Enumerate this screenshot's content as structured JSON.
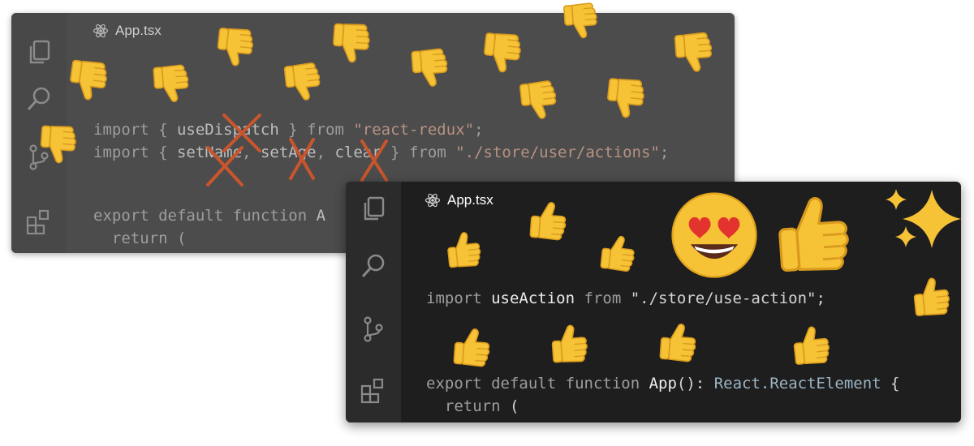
{
  "back_window": {
    "tab": {
      "title": "App.tsx",
      "icon": "react-icon"
    },
    "activity_icons": [
      "files-icon",
      "search-icon",
      "source-control-icon",
      "extensions-icon"
    ],
    "code": {
      "l1": {
        "kw1": "import",
        "p1": " { ",
        "name": "useDispatch",
        "p2": " } ",
        "kw2": "from",
        "p3": " ",
        "str": "\"react-redux\"",
        "end": ";"
      },
      "l2": {
        "kw1": "import",
        "p1": " { ",
        "a": "setName",
        "p2": ", ",
        "b": "setAge",
        "p3": ", ",
        "c": "clear",
        "p4": " } ",
        "kw2": "from",
        "p5": " ",
        "str": "\"./store/user/actions\"",
        "end": ";"
      },
      "l3": {
        "kw1": "export",
        "p1": " ",
        "kw2": "default",
        "p2": " ",
        "kw3": "function",
        "p3": " ",
        "name": "A"
      },
      "l4": {
        "indent": "  ",
        "kw": "return",
        "p": " ("
      }
    },
    "strike_color": "#c9552c",
    "reaction": "thumbs-down"
  },
  "front_window": {
    "tab": {
      "title": "App.tsx",
      "icon": "react-icon"
    },
    "activity_icons": [
      "files-icon",
      "search-icon",
      "source-control-icon",
      "extensions-icon"
    ],
    "code": {
      "l1": {
        "kw1": "import",
        "p1": " ",
        "name": "useAction",
        "p2": " ",
        "kw2": "from",
        "p3": " ",
        "str": "\"./store/use-action\"",
        "end": ";"
      },
      "l2": {
        "kw1": "export",
        "p1": " ",
        "kw2": "default",
        "p2": " ",
        "kw3": "function",
        "p3": " ",
        "name": "App",
        "sig": "(): ",
        "type": "React.ReactElement",
        "brace": " {"
      },
      "l3": {
        "indent": "  ",
        "kw": "return",
        "p": " ("
      }
    },
    "reactions": [
      "thumbs-up",
      "heart-eyes",
      "sparkles"
    ]
  },
  "colors": {
    "emoji_yellow": "#f6c236",
    "back_bg": "#4c4c4c",
    "front_bg": "#1e1e1e"
  }
}
